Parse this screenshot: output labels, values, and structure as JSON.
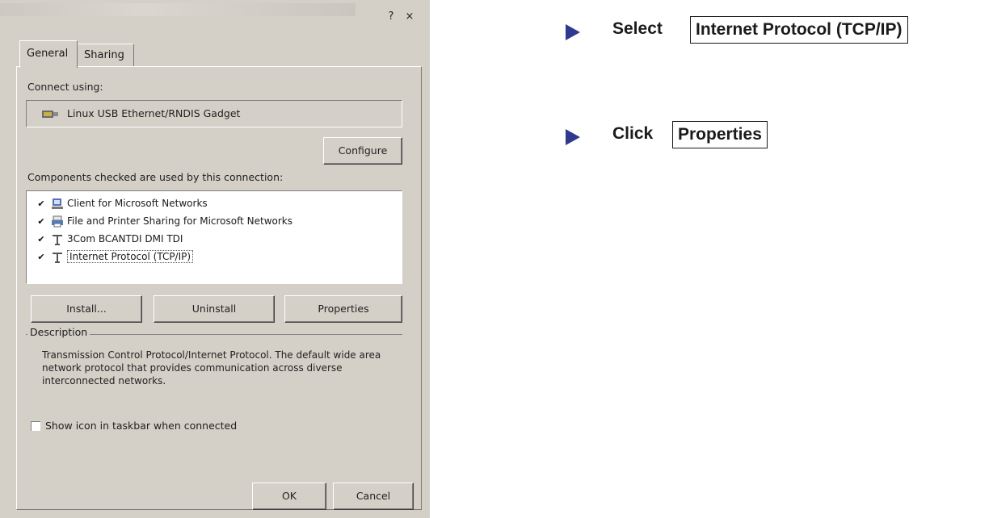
{
  "dialog": {
    "title_buttons": {
      "help": "?",
      "close": "×"
    },
    "tabs": [
      {
        "label": "General",
        "active": true
      },
      {
        "label": "Sharing",
        "active": false
      }
    ],
    "connect_using_label": "Connect using:",
    "adapter": {
      "icon": "network-adapter-icon",
      "name": "Linux USB Ethernet/RNDIS Gadget"
    },
    "configure_button": "Configure",
    "components_label": "Components checked are used by this connection:",
    "components": [
      {
        "label": "Client for Microsoft Networks",
        "checked": true,
        "icon": "client-network-icon",
        "selected": false
      },
      {
        "label": "File and Printer Sharing for Microsoft Networks",
        "checked": true,
        "icon": "printer-sharing-icon",
        "selected": false
      },
      {
        "label": "3Com BCANTDI DMI TDI",
        "checked": true,
        "icon": "protocol-icon",
        "selected": false
      },
      {
        "label": "Internet Protocol (TCP/IP)",
        "checked": true,
        "icon": "protocol-icon",
        "selected": true
      }
    ],
    "buttons": {
      "install": "Install...",
      "uninstall": "Uninstall",
      "properties": "Properties"
    },
    "description": {
      "legend": "Description",
      "text": "Transmission Control Protocol/Internet Protocol. The default wide area network protocol that provides communication across diverse interconnected networks."
    },
    "show_icon_checkbox": {
      "label": "Show icon in taskbar when connected",
      "checked": false
    },
    "footer": {
      "ok": "OK",
      "cancel": "Cancel"
    }
  },
  "instructions": [
    {
      "verb": "Select",
      "target": "Internet Protocol (TCP/IP)",
      "icon": "arrow-right-icon"
    },
    {
      "verb": "Click",
      "target": "Properties",
      "icon": "arrow-right-icon"
    }
  ],
  "colors": {
    "dialog_bg": "#d4d0c8",
    "arrow": "#2f3a8f"
  }
}
